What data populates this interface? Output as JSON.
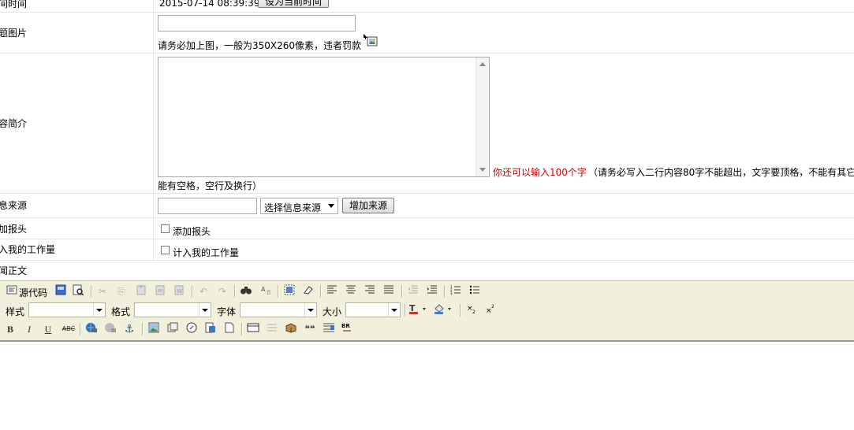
{
  "form": {
    "time_row": {
      "label": "间时间",
      "value": "2015-07-14 08:39:39",
      "button": "设为当前时间"
    },
    "image_row": {
      "label": "题图片",
      "value": "",
      "hint": "请务必加上图，一般为350X260像素，违者罚款"
    },
    "summary_row": {
      "label": "容简介",
      "value": "",
      "counter": "你还可以输入100个字",
      "note": "（请务必写入二行内容80字不能超出，文字要顶格，不能有其它",
      "note_cont": "能有空格，空行及换行）"
    },
    "source_row": {
      "label": "息来源",
      "value": "",
      "select_value": "选择信息来源",
      "button": "增加来源"
    },
    "header_row": {
      "label": "加报头",
      "checkbox_label": "添加报头"
    },
    "workload_row": {
      "label": "入我的工作量",
      "checkbox_label": "计入我的工作量"
    },
    "body_row": {
      "label": "闻正文"
    }
  },
  "editor": {
    "source_label": "源代码",
    "style_label": "样式",
    "format_label": "格式",
    "font_label": "字体",
    "size_label": "大小",
    "style_value": "",
    "format_value": "",
    "font_value": "",
    "size_value": "",
    "bold": "B",
    "italic": "I",
    "underline": "U",
    "strike": "ABC",
    "quote": "❝❝",
    "colors": {
      "toolbar_bg": "#f0f0dc",
      "counter_red": "#cc0000"
    }
  }
}
